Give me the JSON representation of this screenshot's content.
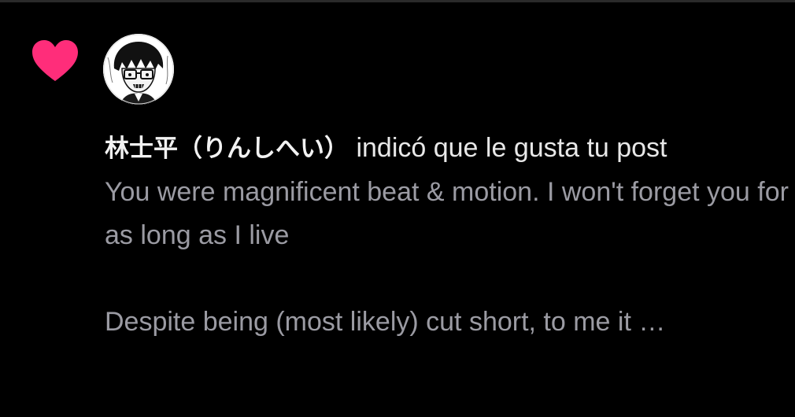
{
  "notification": {
    "icon": "heart-icon",
    "icon_color": "#ff2d7a",
    "avatar": "avatar-manga-character",
    "username": "林士平（りんしへい）",
    "action_text": "indicó que le gusta tu post",
    "comment_lines": [
      "You were magnificent beat & motion. I won't forget you for as long as I live",
      "Despite being (most likely) cut short, to me it …"
    ]
  }
}
